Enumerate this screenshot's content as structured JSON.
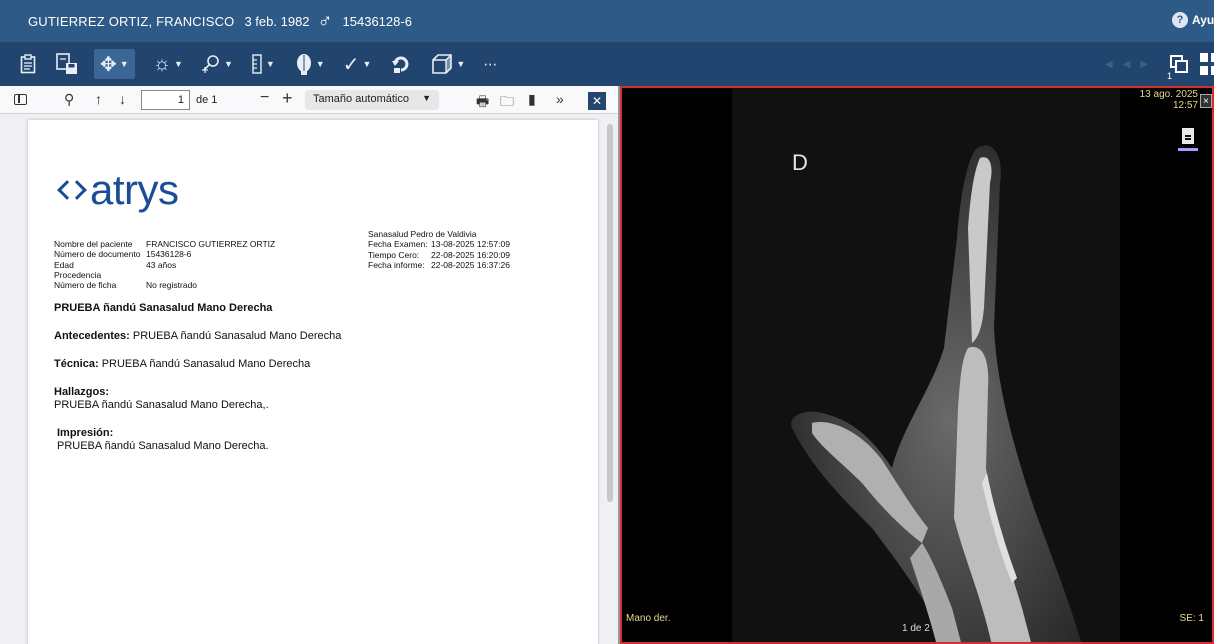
{
  "titlebar": {
    "patient_name": "GUTIERREZ ORTIZ, FRANCISCO",
    "birth_date": "3 feb. 1982",
    "sex_symbol": "♂",
    "document_id": "15436128-6",
    "help_label": "Ayud"
  },
  "toolbar": {
    "tools": [
      {
        "icon": "clipboard-icon",
        "glyph": "📋"
      },
      {
        "icon": "save-to-disk-icon",
        "glyph": "💾"
      },
      {
        "icon": "pan-tool-icon",
        "glyph": "✥",
        "selected": true
      },
      {
        "icon": "brightness-icon",
        "glyph": "☼"
      },
      {
        "icon": "zoom-tool-icon",
        "glyph": "⚲"
      },
      {
        "icon": "ruler-icon",
        "glyph": "▯"
      },
      {
        "icon": "anatomy-icon",
        "glyph": "♟"
      },
      {
        "icon": "checkmark-icon",
        "glyph": "✓"
      },
      {
        "icon": "reset-icon",
        "glyph": "↻"
      },
      {
        "icon": "cube-3d-icon",
        "glyph": "⬚"
      },
      {
        "icon": "more-icon",
        "glyph": "⋯"
      }
    ],
    "window_badge": "1"
  },
  "pdf_toolbar": {
    "page_current": "1",
    "page_of": "de 1",
    "zoom_value": "Tamaño automático"
  },
  "report": {
    "logo_text": "atrys",
    "patient_fields": [
      {
        "label": "Nombre del paciente",
        "value": "FRANCISCO  GUTIERREZ ORTIZ"
      },
      {
        "label": "Número de documento",
        "value": "15436128-6"
      },
      {
        "label": "Edad",
        "value": "43 años"
      },
      {
        "label": "Procedencia",
        "value": ""
      },
      {
        "label": "Número de ficha",
        "value": "No registrado"
      }
    ],
    "clinic": "Sanasalud Pedro de Valdivia",
    "exam_fields": [
      {
        "label": "Fecha Examen:",
        "value": "13-08-2025  12:57:09"
      },
      {
        "label": "Tiempo Cero:",
        "value": "22-08-2025  16:20:09"
      },
      {
        "label": "Fecha informe:",
        "value": "22-08-2025  16:37:26"
      }
    ],
    "title": "PRUEBA ñandú Sanasalud Mano Derecha",
    "antecedentes_label": "Antecedentes:",
    "antecedentes_text": " PRUEBA ñandú Sanasalud Mano Derecha",
    "tecnica_label": "Técnica:",
    "tecnica_text": " PRUEBA ñandú Sanasalud Mano Derecha",
    "hallazgos_label": "Hallazgos:",
    "hallazgos_text": "PRUEBA ñandú Sanasalud Mano Derecha,.",
    "impresion_label": "Impresión:",
    "impresion_text": "PRUEBA ñandú Sanasalud Mano Derecha."
  },
  "viewer": {
    "orientation_marker": "D",
    "study_date": "13 ago. 2025",
    "study_time": "12:57",
    "series_label": "Mano der.",
    "image_counter": "1 de 2",
    "series_number": "SE: 1",
    "close_glyph": "×"
  }
}
